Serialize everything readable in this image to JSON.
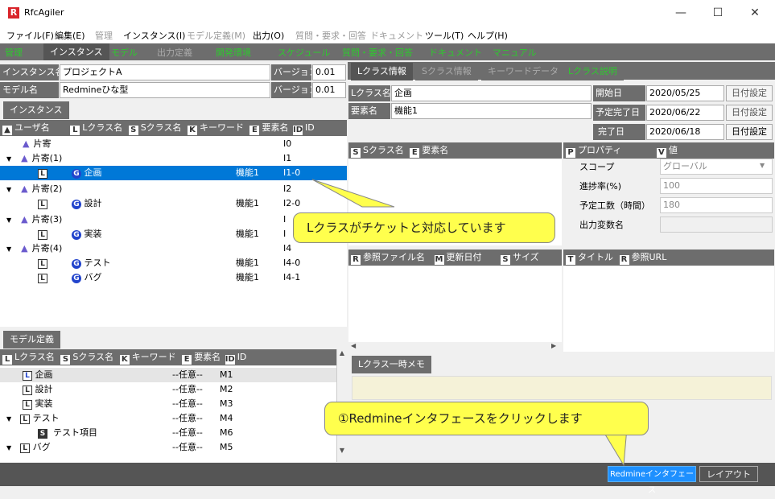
{
  "window": {
    "title": "RfcAgiler",
    "icon": "R"
  },
  "menu": [
    "ファイル(F)",
    "編集(E)",
    "管理",
    "インスタンス(I)",
    "モデル定義(M)",
    "出力(O)",
    "質問・要求・回答",
    "ドキュメント",
    "ツール(T)",
    "ヘルプ(H)"
  ],
  "toolbar": [
    "管理",
    "インスタンス",
    "モデル",
    "出力定義",
    "開発環境",
    "スケジュール",
    "質問・要求・回答",
    "ドキュメント",
    "マニュアル"
  ],
  "instance": {
    "name_label": "インスタンス名",
    "name": "プロジェクトA",
    "version_label": "バージョン",
    "version": "0.01"
  },
  "model": {
    "name_label": "モデル名",
    "name": "Redmineひな型",
    "version_label": "バージョン",
    "version": "0.01"
  },
  "instance_tab": "インスタンス",
  "instance_headers": {
    "user": "ユーザ名",
    "lclass": "Lクラス名",
    "sclass": "Sクラス名",
    "keyword": "キーワード",
    "element": "要素名",
    "id": "ID"
  },
  "tree": [
    {
      "label": "片寄",
      "element": "",
      "id": "I0"
    },
    {
      "label": "片寄(1)",
      "element": "",
      "id": "I1"
    },
    {
      "label": "企画",
      "element": "機能1",
      "id": "I1-0"
    },
    {
      "label": "片寄(2)",
      "element": "",
      "id": "I2"
    },
    {
      "label": "設計",
      "element": "機能1",
      "id": "I2-0"
    },
    {
      "label": "片寄(3)",
      "element": "",
      "id": "I"
    },
    {
      "label": "実装",
      "element": "機能1",
      "id": "I"
    },
    {
      "label": "片寄(4)",
      "element": "",
      "id": "I4"
    },
    {
      "label": "テスト",
      "element": "機能1",
      "id": "I4-0"
    },
    {
      "label": "バグ",
      "element": "機能1",
      "id": "I4-1"
    }
  ],
  "model_tab": "モデル定義",
  "model_headers": {
    "lclass": "Lクラス名",
    "sclass": "Sクラス名",
    "keyword": "キーワード",
    "element": "要素名",
    "id": "ID"
  },
  "model_rows": [
    {
      "label": "企画",
      "element": "--任意--",
      "id": "M1"
    },
    {
      "label": "設計",
      "element": "--任意--",
      "id": "M2"
    },
    {
      "label": "実装",
      "element": "--任意--",
      "id": "M3"
    },
    {
      "label": "テスト",
      "element": "--任意--",
      "id": "M4"
    },
    {
      "label": "テスト項目",
      "element": "--任意--",
      "id": "M6"
    },
    {
      "label": "バグ",
      "element": "--任意--",
      "id": "M5"
    }
  ],
  "right_tabs": [
    "Lクラス情報",
    "Sクラス情報",
    "キーワードデータ",
    "Lクラス説明"
  ],
  "lclass": {
    "name_label": "Lクラス名",
    "name": "企画",
    "element_label": "要素名",
    "element": "機能1"
  },
  "dates": {
    "start_label": "開始日",
    "start": "2020/05/25",
    "plan_label": "予定完了日",
    "plan": "2020/06/22",
    "done_label": "完了日",
    "done": "2020/06/18",
    "set_label": "日付設定"
  },
  "sclass_headers": {
    "sclass": "Sクラス名",
    "element": "要素名"
  },
  "prop_headers": {
    "prop": "プロパティ",
    "value": "値"
  },
  "props": [
    {
      "name": "スコープ",
      "value": "グローバル"
    },
    {
      "name": "進捗率(%)",
      "value": "100"
    },
    {
      "name": "予定工数（時間）",
      "value": "180"
    },
    {
      "name": "出力変数名",
      "value": ""
    }
  ],
  "ref_headers": {
    "file": "参照ファイル名",
    "date": "更新日付",
    "size": "サイズ"
  },
  "url_headers": {
    "title": "タイトル",
    "url": "参照URL"
  },
  "memo_tab": "Lクラス一時メモ",
  "callouts": {
    "ticket": "Lクラスがチケットと対応しています",
    "click": "①Redmineインタフェースをクリックします"
  },
  "status": {
    "redmine": "Redmineインタフェース",
    "layout": "レイアウト"
  }
}
